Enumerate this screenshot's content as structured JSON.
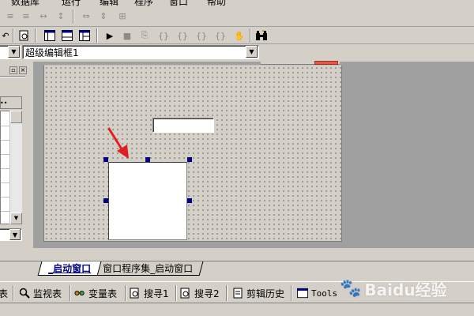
{
  "menubar": {
    "items": [
      "数据库",
      "运行",
      "编辑",
      "程序",
      "窗口",
      "帮助"
    ]
  },
  "toolbar2": {
    "buttons": [
      "undo-icon",
      "find-icon",
      "layout1-icon",
      "layout2-icon",
      "layout3-icon",
      "run-icon",
      "stop-icon",
      "step-icon",
      "step-into-icon",
      "step-out-icon",
      "run-to-icon",
      "hand-icon",
      "binoculars-icon"
    ]
  },
  "combo_row": {
    "left_combo_value": "",
    "main_combo_value": "超级编辑框1"
  },
  "tabs": {
    "active": "_启动窗口",
    "inactive": "窗口程序集_启动窗口"
  },
  "bottombar": {
    "items": [
      {
        "label": "表",
        "icon": "table-icon"
      },
      {
        "label": "监视表",
        "icon": "search-icon"
      },
      {
        "label": "变量表",
        "icon": "variables-icon"
      },
      {
        "label": "搜寻1",
        "icon": "search-doc-icon"
      },
      {
        "label": "搜寻2",
        "icon": "search-doc-icon"
      },
      {
        "label": "剪辑历史",
        "icon": "clipboard-icon"
      },
      {
        "label": "Tools",
        "icon": "window-icon"
      }
    ]
  },
  "watermark": {
    "text": "Baidu经验"
  },
  "colors": {
    "annotation_arrow": "#e02020",
    "handle": "#000080",
    "active_tab_text": "#000080"
  }
}
